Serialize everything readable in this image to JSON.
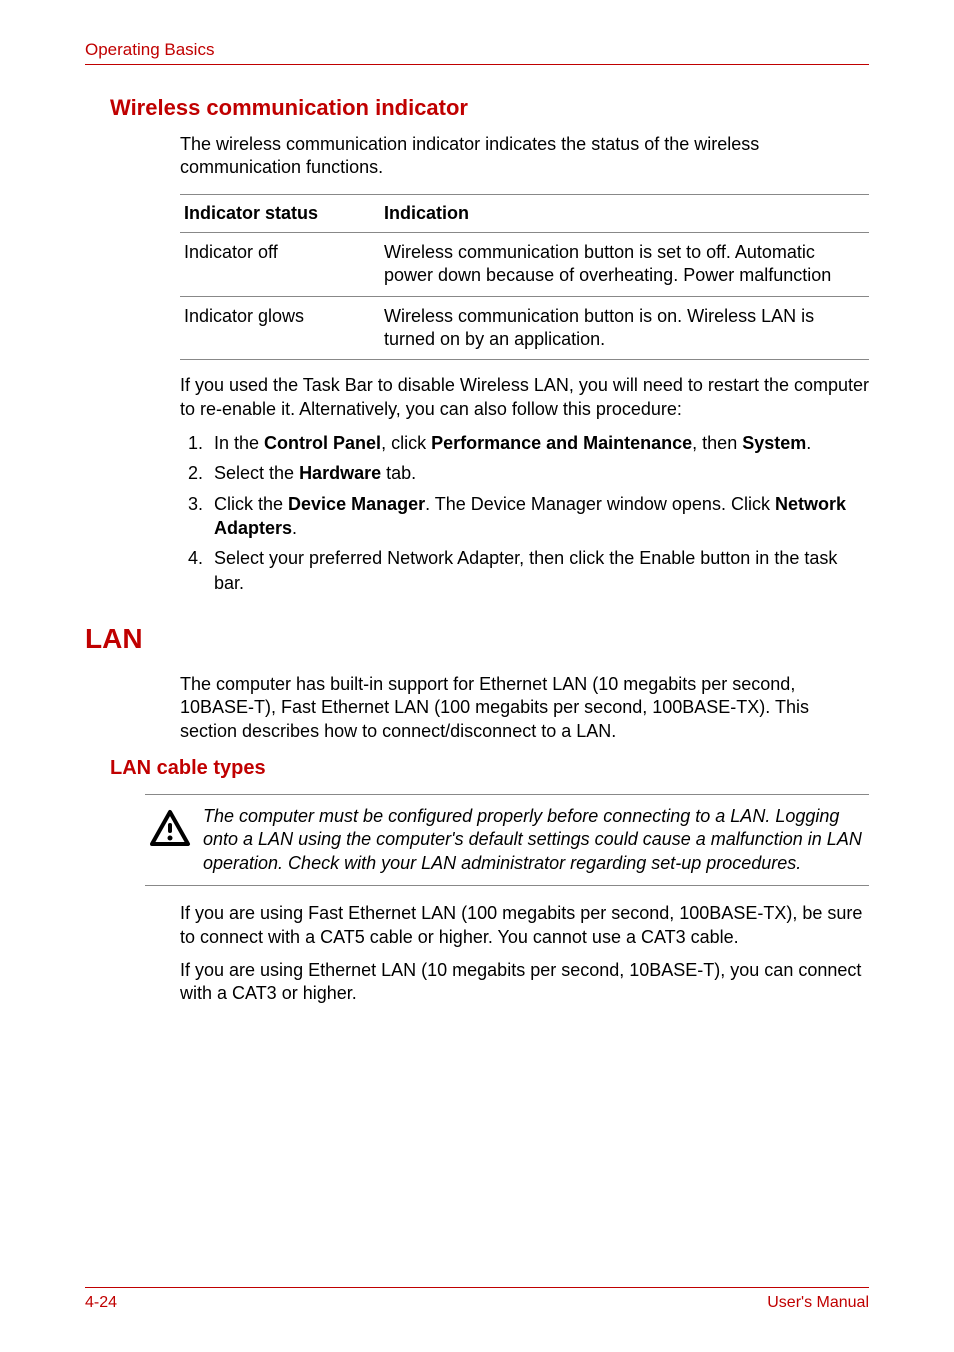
{
  "header": {
    "section": "Operating Basics"
  },
  "wireless": {
    "heading": "Wireless communication indicator",
    "intro": "The wireless communication indicator indicates the status of the wireless communication functions.",
    "table": {
      "col1_header": "Indicator status",
      "col2_header": "Indication",
      "rows": [
        {
          "status": "Indicator off",
          "indication": "Wireless communication button is set to off. Automatic power down because of overheating. Power malfunction"
        },
        {
          "status": "Indicator glows",
          "indication": "Wireless communication button is on. Wireless LAN is turned on by an application."
        }
      ]
    },
    "after_table": "If you used the Task Bar to disable Wireless LAN, you will need to restart the computer to re-enable it. Alternatively, you can also follow this procedure:",
    "steps": {
      "s1_a": "In the ",
      "s1_b": "Control Panel",
      "s1_c": ", click ",
      "s1_d": "Performance and Maintenance",
      "s1_e": ", then ",
      "s1_f": "System",
      "s1_g": ".",
      "s2_a": "Select the ",
      "s2_b": "Hardware",
      "s2_c": " tab.",
      "s3_a": "Click the ",
      "s3_b": "Device Manager",
      "s3_c": ". The Device Manager window opens. Click ",
      "s3_d": "Network Adapters",
      "s3_e": ".",
      "s4": "Select your preferred Network Adapter, then click the Enable button in the task bar."
    }
  },
  "lan": {
    "heading": "LAN",
    "intro": "The computer has built-in support for Ethernet LAN (10 megabits per second, 10BASE-T), Fast Ethernet LAN (100 megabits per second, 100BASE-TX). This section describes how to connect/disconnect to a LAN.",
    "cable_heading": "LAN cable types",
    "caution": "The computer must be configured properly before connecting to a LAN. Logging onto a LAN using the computer's default settings could cause a malfunction in LAN operation. Check with your LAN administrator regarding set-up procedures.",
    "p1": "If you are using Fast Ethernet LAN (100 megabits per second, 100BASE-TX), be sure to connect with a CAT5 cable or higher. You cannot use a CAT3 cable.",
    "p2": "If you are using Ethernet LAN (10 megabits per second, 10BASE-T), you can connect with a CAT3 or higher."
  },
  "footer": {
    "page": "4-24",
    "manual": "User's Manual"
  }
}
